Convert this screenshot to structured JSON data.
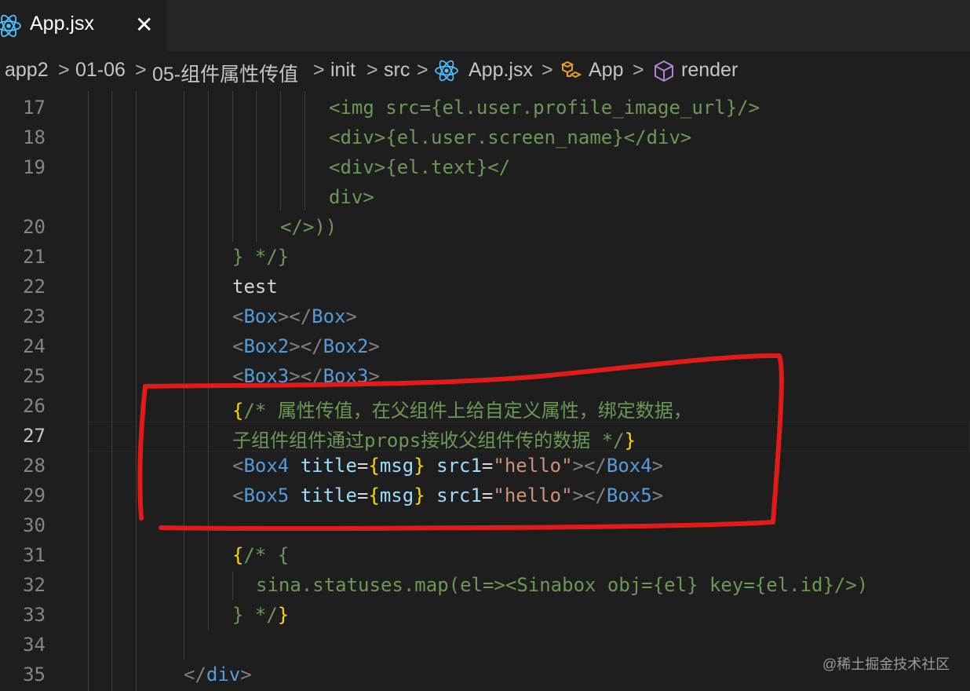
{
  "tab": {
    "name": "App.jsx",
    "close": "✕",
    "icon": "react-icon"
  },
  "breadcrumb": {
    "items": [
      "app2",
      "01-06",
      "05-组件属性传值",
      "init",
      "src",
      "App.jsx",
      "App",
      "render"
    ],
    "separator": ">"
  },
  "editor": {
    "line_numbers": [
      "17",
      "18",
      "19",
      "20",
      "21",
      "22",
      "23",
      "24",
      "25",
      "26",
      "27",
      "28",
      "29",
      "30",
      "31",
      "32",
      "33",
      "34",
      "35"
    ],
    "active_line": "27",
    "lines": {
      "l17": "<img src={el.user.profile_image_url}/>",
      "l18": "<div>{el.user.screen_name}</div>",
      "l19a": "<div>{el.text}</",
      "l19b": "div>",
      "l20": "</>))",
      "l21": "} */}",
      "l22": "test",
      "l23": {
        "o": "<",
        "t1": "Box",
        "m": "></",
        "t2": "Box",
        "c": ">"
      },
      "l24": {
        "o": "<",
        "t1": "Box2",
        "m": "></",
        "t2": "Box2",
        "c": ">"
      },
      "l25": {
        "o": "<",
        "t1": "Box3",
        "m": "></",
        "t2": "Box3",
        "c": ">"
      },
      "l26": {
        "b": "{",
        "com1": "/* ",
        "cjk": "属性传值，在父组件上给自定义属性，绑定数据，"
      },
      "l27": {
        "cjk1": "子组件组件通过",
        "props": "props",
        "cjk2": "接收父组件传的数据",
        "end": " */",
        "b": "}"
      },
      "l28": {
        "o": "<",
        "tag": "Box4",
        "sp": " ",
        "a1": "title",
        "eq": "=",
        "b1": "{",
        "v1": "msg",
        "b2": "}",
        "sp2": " ",
        "a2": "src1",
        "eq2": "=",
        "s": "\"hello\"",
        "m": "></",
        "tag2": "Box4",
        "c": ">"
      },
      "l29": {
        "o": "<",
        "tag": "Box5",
        "sp": " ",
        "a1": "title",
        "eq": "=",
        "b1": "{",
        "v1": "msg",
        "b2": "}",
        "sp2": " ",
        "a2": "src1",
        "eq2": "=",
        "s": "\"hello\"",
        "m": "></",
        "tag2": "Box5",
        "c": ">"
      },
      "l31": {
        "b": "{",
        "com": "/* {"
      },
      "l32": "sina.statuses.map(el=><Sinabox obj={el} key={el.id}/>)",
      "l33": {
        "com": "} */",
        "b": "}"
      },
      "l35": {
        "o": "</",
        "tag": "div",
        "c": ">"
      }
    }
  },
  "watermark": "@稀土掘金技术社区",
  "colors": {
    "comment": "#6a9955",
    "tag": "#569cd6",
    "attr": "#9cdcfe",
    "string": "#ce9178",
    "bracket": "#ffd700",
    "annotation": "#e11b1b"
  }
}
